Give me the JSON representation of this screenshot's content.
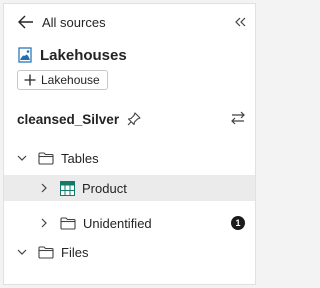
{
  "nav": {
    "back_label": "All sources"
  },
  "lakehouse": {
    "title": "Lakehouses",
    "add_button_label": "Lakehouse"
  },
  "item": {
    "name": "cleansed_Silver"
  },
  "tree": {
    "tables_label": "Tables",
    "product_label": "Product",
    "unidentified_label": "Unidentified",
    "unidentified_count": "1",
    "files_label": "Files"
  },
  "colors": {
    "lakehouse_icon": "#1f6fb5",
    "table_icon": "#137a6b",
    "selected_row": "#ebebeb"
  }
}
